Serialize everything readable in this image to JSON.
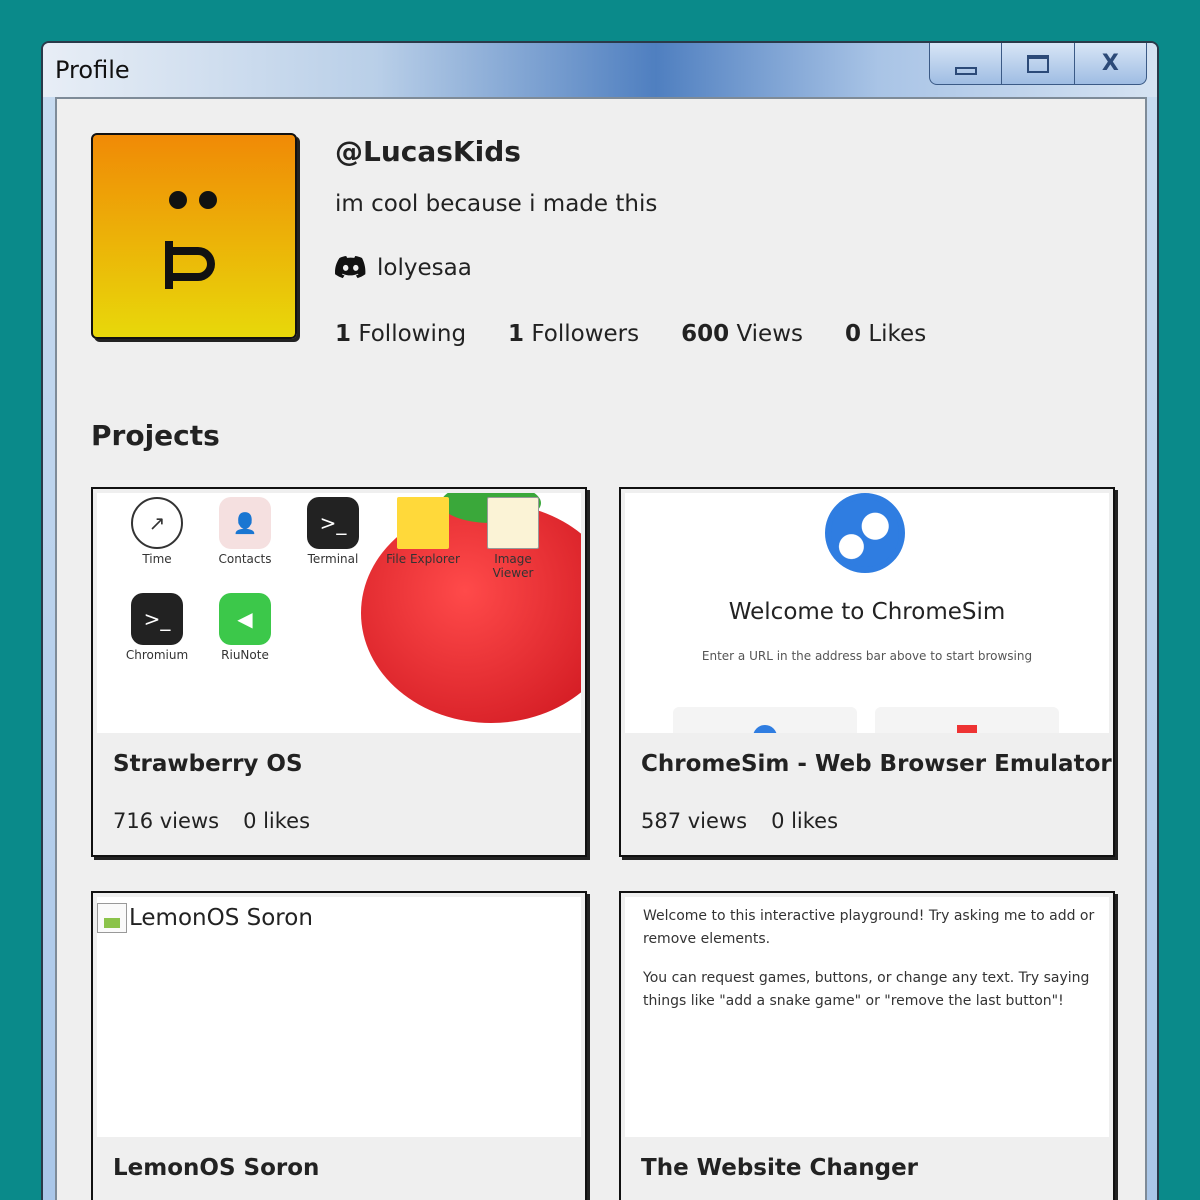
{
  "window": {
    "title": "Profile",
    "controls": {
      "minimize": "minimize",
      "maximize": "maximize",
      "close": "X"
    }
  },
  "profile": {
    "username": "@LucasKids",
    "bio": "im cool because i made this",
    "discord": "lolyesaa",
    "stats": [
      {
        "count": "1",
        "label": "Following"
      },
      {
        "count": "1",
        "label": "Followers"
      },
      {
        "count": "600",
        "label": "Views"
      },
      {
        "count": "0",
        "label": "Likes"
      }
    ]
  },
  "projects": {
    "heading": "Projects",
    "items": [
      {
        "title": "Strawberry OS",
        "views": "716 views",
        "likes": "0 likes",
        "thumb_apps": [
          "Time",
          "Contacts",
          "Terminal",
          "File Explorer",
          "Image Viewer",
          "Chromium",
          "RiuNote"
        ]
      },
      {
        "title": "ChromeSim - Web Browser Emulator",
        "views": "587 views",
        "likes": "0 likes",
        "thumb_heading": "Welcome to ChromeSim",
        "thumb_sub": "Enter a URL in the address bar above to start browsing"
      },
      {
        "title": "LemonOS Soron",
        "thumb_alt": "LemonOS Soron"
      },
      {
        "title": "The Website Changer",
        "thumb_p1": "Welcome to this interactive playground! Try asking me to add or remove elements.",
        "thumb_p2": "You can request games, buttons, or change any text. Try saying things like \"add a snake game\" or \"remove the last button\"!"
      }
    ]
  },
  "colors": {
    "desktop": "#0a8a8a",
    "panel": "#efefef",
    "avatar_top": "#f08a06",
    "avatar_bottom": "#e8d80a",
    "accent_blue": "#2f7de1"
  }
}
